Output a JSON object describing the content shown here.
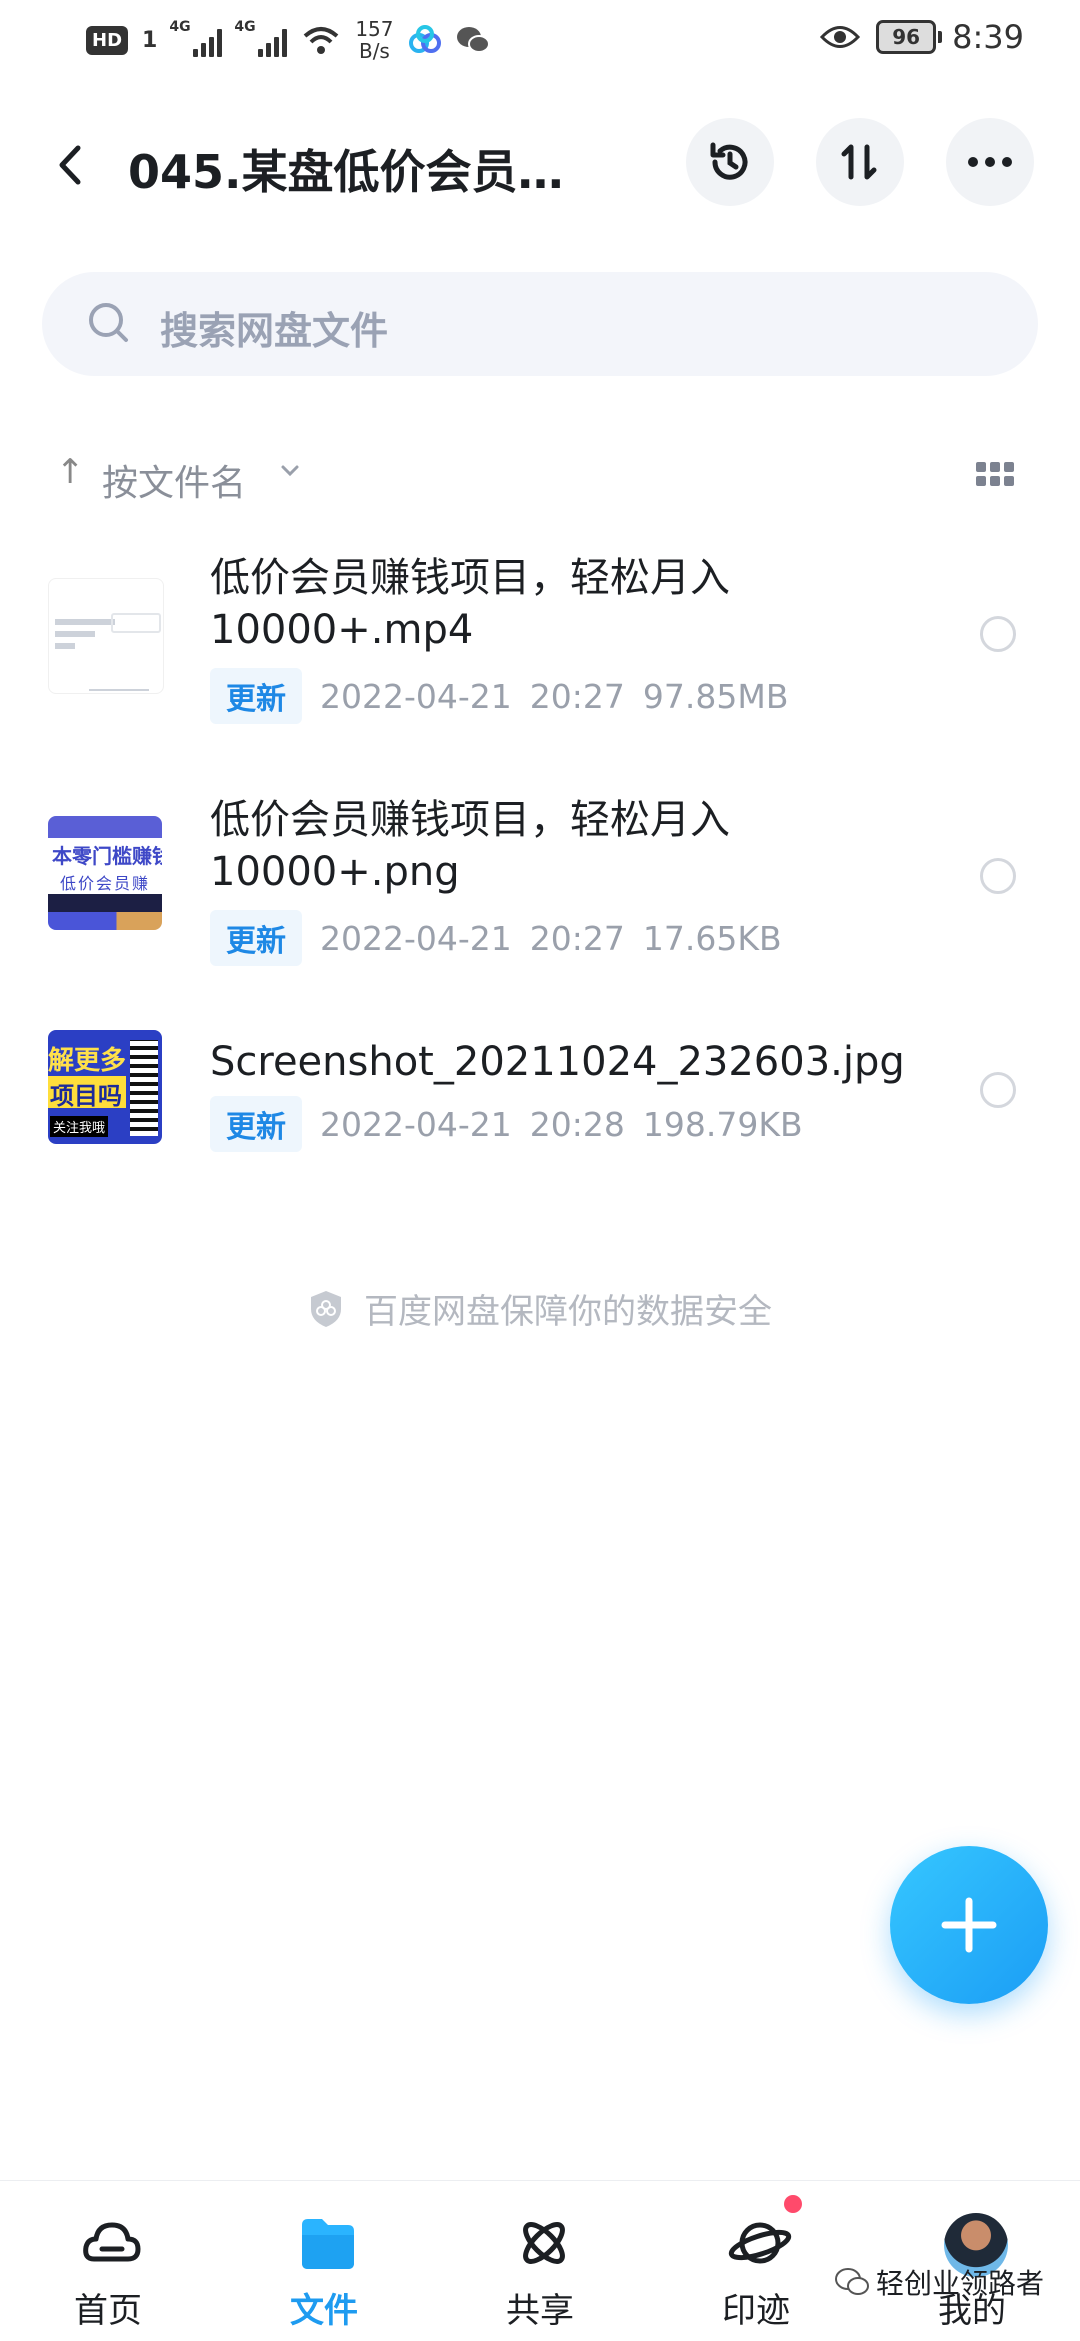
{
  "status_bar": {
    "hd": "HD",
    "sim": "1",
    "net1": "4G",
    "net2": "4G",
    "speed_value": "157",
    "speed_unit": "B/s",
    "battery": "96",
    "time": "8:39"
  },
  "header": {
    "title": "045.某盘低价会员…"
  },
  "search": {
    "placeholder": "搜索网盘文件"
  },
  "sort": {
    "arrow": "↑",
    "label": "按文件名"
  },
  "files": [
    {
      "name": "低价会员赚钱项目，轻松月入10000+.mp4",
      "badge": "更新",
      "date": "2022-04-21",
      "time": "20:27",
      "size": "97.85MB",
      "thumb": "video"
    },
    {
      "name": "低价会员赚钱项目，轻松月入10000+.png",
      "badge": "更新",
      "date": "2022-04-21",
      "time": "20:27",
      "size": "17.65KB",
      "thumb": "png",
      "thumb_text1": "本零门槛赚钱",
      "thumb_text2": "低价会员赚"
    },
    {
      "name": "Screenshot_20211024_232603.jpg",
      "badge": "更新",
      "date": "2022-04-21",
      "time": "20:28",
      "size": "198.79KB",
      "thumb": "jpg",
      "thumb_text1": "解更多",
      "thumb_text2": "项目吗",
      "thumb_text3": "关注我哦"
    }
  ],
  "security_note": "百度网盘保障你的数据安全",
  "bottom_nav": [
    {
      "label": "首页",
      "icon": "home-cloud-icon",
      "active": false
    },
    {
      "label": "文件",
      "icon": "folder-icon",
      "active": true
    },
    {
      "label": "共享",
      "icon": "share-atom-icon",
      "active": false
    },
    {
      "label": "印迹",
      "icon": "planet-icon",
      "active": false,
      "has_dot": true
    },
    {
      "label": "我的",
      "icon": "avatar",
      "active": false
    }
  ],
  "watermark": "轻创业领路者",
  "colors": {
    "accent": "#1e9bf0",
    "badge_text": "#1e88e5",
    "notification_dot": "#ff4a6b"
  }
}
